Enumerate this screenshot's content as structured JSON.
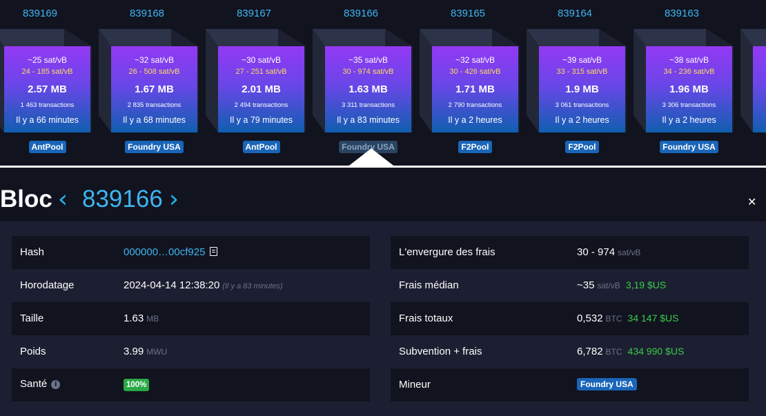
{
  "blocks": [
    {
      "height": "839169",
      "median": "~25 sat/vB",
      "range": "24 - 185 sat/vB",
      "size": "2.57 MB",
      "tx": "1 463 transactions",
      "time": "Il y a 66 minutes",
      "pool": "AntPool"
    },
    {
      "height": "839168",
      "median": "~32 sat/vB",
      "range": "26 - 508 sat/vB",
      "size": "1.67 MB",
      "tx": "2 835 transactions",
      "time": "Il y a 68 minutes",
      "pool": "Foundry USA"
    },
    {
      "height": "839167",
      "median": "~30 sat/vB",
      "range": "27 - 251 sat/vB",
      "size": "2.01 MB",
      "tx": "2 494 transactions",
      "time": "Il y a 79 minutes",
      "pool": "AntPool"
    },
    {
      "height": "839166",
      "median": "~35 sat/vB",
      "range": "30 - 974 sat/vB",
      "size": "1.63 MB",
      "tx": "3 311 transactions",
      "time": "Il y a 83 minutes",
      "pool": "Foundry USA"
    },
    {
      "height": "839165",
      "median": "~32 sat/vB",
      "range": "30 - 426 sat/vB",
      "size": "1.71 MB",
      "tx": "2 790 transactions",
      "time": "Il y a 2 heures",
      "pool": "F2Pool"
    },
    {
      "height": "839164",
      "median": "~39 sat/vB",
      "range": "33 - 315 sat/vB",
      "size": "1.9 MB",
      "tx": "3 061 transactions",
      "time": "Il y a 2 heures",
      "pool": "F2Pool"
    },
    {
      "height": "839163",
      "median": "~38 sat/vB",
      "range": "34 - 236 sat/vB",
      "size": "1.96 MB",
      "tx": "3 306 transactions",
      "time": "Il y a 2 heures",
      "pool": "Foundry USA"
    }
  ],
  "header": {
    "title": "Bloc",
    "prev_icon": "chevron-left-icon",
    "next_icon": "chevron-right-icon",
    "height": "839166",
    "close_icon": "close-icon"
  },
  "left": {
    "hash": {
      "label": "Hash",
      "value": "000000…00cf925",
      "icon": "copy-icon"
    },
    "timestamp": {
      "label": "Horodatage",
      "value": "2024-04-14 12:38:20",
      "ago": "(Il y a 83 minutes)"
    },
    "size": {
      "label": "Taille",
      "value": "1.63",
      "unit": "MB"
    },
    "weight": {
      "label": "Poids",
      "value": "3.99",
      "unit": "MWU"
    },
    "health": {
      "label": "Santé",
      "value": "100%",
      "icon": "info-icon"
    }
  },
  "right": {
    "fee_span": {
      "label": "L'envergure des frais",
      "value": "30 - 974",
      "unit": "sat/vB"
    },
    "median_fee": {
      "label": "Frais médian",
      "value": "~35",
      "unit": "sat/vB",
      "usd": "3,19 $US"
    },
    "total_fees": {
      "label": "Frais totaux",
      "value": "0,532",
      "unit": "BTC",
      "usd": "34 147 $US"
    },
    "subsidy": {
      "label": "Subvention + frais",
      "value": "6,782",
      "unit": "BTC",
      "usd": "434 990 $US"
    },
    "miner": {
      "label": "Mineur",
      "value": "Foundry USA"
    }
  },
  "colors": {
    "accent": "#3eb6f0",
    "usd": "#3bcc49",
    "range": "#fedc5a",
    "badge": "#1a65b8",
    "health": "#2aa846"
  }
}
